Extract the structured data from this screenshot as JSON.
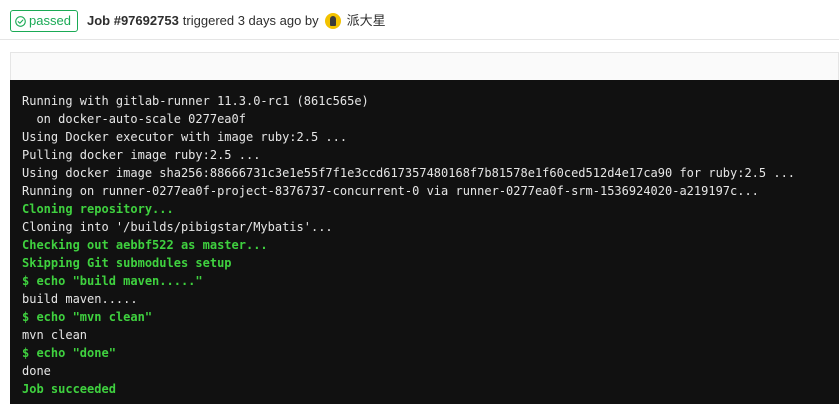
{
  "status": {
    "label": "passed",
    "icon": "check-circle-icon",
    "color": "#1aaa55"
  },
  "job": {
    "id": "Job #97692753",
    "meta": "triggered 3 days ago by",
    "user": "派大星"
  },
  "log": {
    "lines": [
      {
        "text": "Running with gitlab-runner 11.3.0-rc1 (861c565e)",
        "style": "normal"
      },
      {
        "text": "  on docker-auto-scale 0277ea0f",
        "style": "normal"
      },
      {
        "text": "Using Docker executor with image ruby:2.5 ...",
        "style": "normal"
      },
      {
        "text": "Pulling docker image ruby:2.5 ...",
        "style": "normal"
      },
      {
        "text": "Using docker image sha256:88666731c3e1e55f7f1e3ccd617357480168f7b81578e1f60ced512d4e17ca90 for ruby:2.5 ...",
        "style": "normal"
      },
      {
        "text": "Running on runner-0277ea0f-project-8376737-concurrent-0 via runner-0277ea0f-srm-1536924020-a219197c...",
        "style": "normal"
      },
      {
        "text": "Cloning repository...",
        "style": "green"
      },
      {
        "text": "Cloning into '/builds/pibigstar/Mybatis'...",
        "style": "normal"
      },
      {
        "text": "Checking out aebbf522 as master...",
        "style": "green"
      },
      {
        "text": "Skipping Git submodules setup",
        "style": "green"
      },
      {
        "text": "$ echo \"build maven.....\"",
        "style": "green"
      },
      {
        "text": "build maven.....",
        "style": "normal"
      },
      {
        "text": "$ echo \"mvn clean\"",
        "style": "green"
      },
      {
        "text": "mvn clean",
        "style": "normal"
      },
      {
        "text": "$ echo \"done\"",
        "style": "green"
      },
      {
        "text": "done",
        "style": "normal"
      },
      {
        "text": "Job succeeded",
        "style": "green"
      }
    ]
  }
}
